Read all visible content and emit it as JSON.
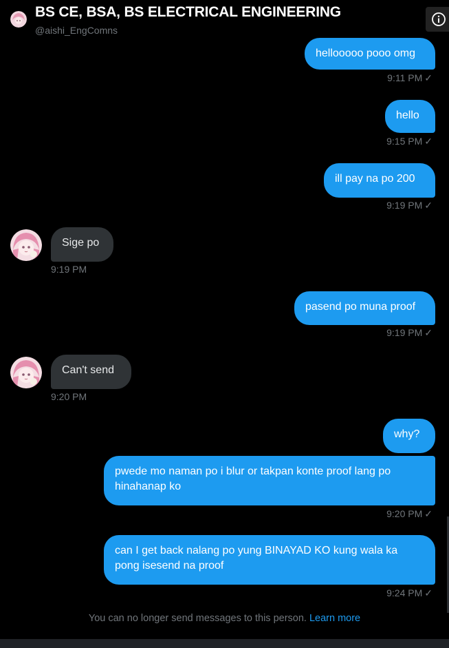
{
  "header": {
    "title": "BS CE, BSA, BS ELECTRICAL ENGINEERING",
    "handle": "@aishi_EngComns",
    "info_icon": "info-circle-icon"
  },
  "messages": [
    {
      "dir": "out",
      "text": "hellooooo pooo omg",
      "time": "9:11 PM"
    },
    {
      "dir": "out",
      "text": "hello",
      "time": "9:15 PM"
    },
    {
      "dir": "out",
      "text": "ill pay na po 200",
      "time": "9:19 PM"
    },
    {
      "dir": "in",
      "text": "Sige po",
      "time": "9:19 PM"
    },
    {
      "dir": "out",
      "text": "pasend po muna proof",
      "time": "9:19 PM"
    },
    {
      "dir": "in",
      "text": "Can't send",
      "time": "9:20 PM"
    },
    {
      "dir": "out",
      "text": "why?",
      "time": ""
    },
    {
      "dir": "out",
      "text": "pwede mo naman po i blur or takpan konte proof lang po hinahanap ko",
      "time": "9:20 PM"
    },
    {
      "dir": "out",
      "text": "can I get back nalang po yung BINAYAD KO kung wala ka pong isesend na proof",
      "time": "9:24 PM"
    }
  ],
  "footer": {
    "notice": "You can no longer send messages to this person.",
    "learn_more": "Learn more"
  },
  "colors": {
    "accent": "#1d9bf0",
    "incoming_bubble": "#2f3336",
    "muted_text": "#71767b"
  }
}
